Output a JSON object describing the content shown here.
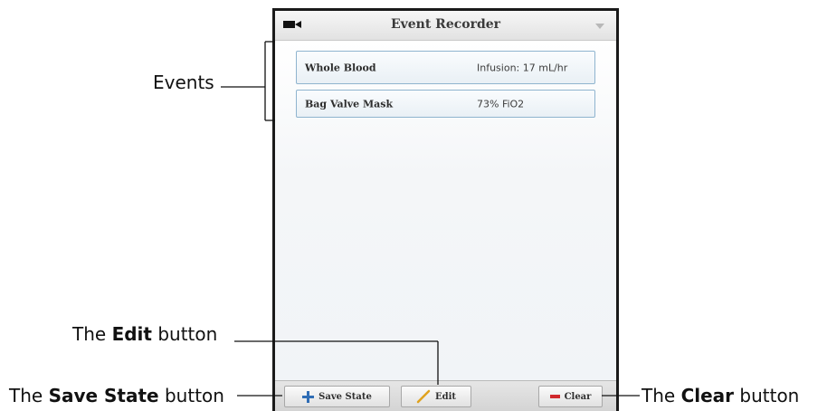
{
  "window": {
    "title": "Event Recorder",
    "camera_icon": "video-camera-icon",
    "dropdown_icon": "chevron-down-icon"
  },
  "events": [
    {
      "name": "Whole Blood",
      "value": "Infusion: 17 mL/hr"
    },
    {
      "name": "Bag Valve Mask",
      "value": "73% FiO2"
    }
  ],
  "toolbar": {
    "save_label": "Save State",
    "edit_label": "Edit",
    "clear_label": "Clear",
    "save_icon": "plus-icon",
    "edit_icon": "pencil-icon",
    "clear_icon": "minus-icon"
  },
  "annotations": {
    "events": "Events",
    "edit_prefix": "The ",
    "edit_bold": "Edit",
    "edit_suffix": " button",
    "save_prefix": "The ",
    "save_bold": "Save State",
    "save_suffix": " button",
    "clear_prefix": "The ",
    "clear_bold": "Clear",
    "clear_suffix": " button"
  },
  "colors": {
    "plus": "#2f6db5",
    "pencil": "#e0a21e",
    "minus": "#d0282c",
    "row_border": "#8fb4cf"
  }
}
